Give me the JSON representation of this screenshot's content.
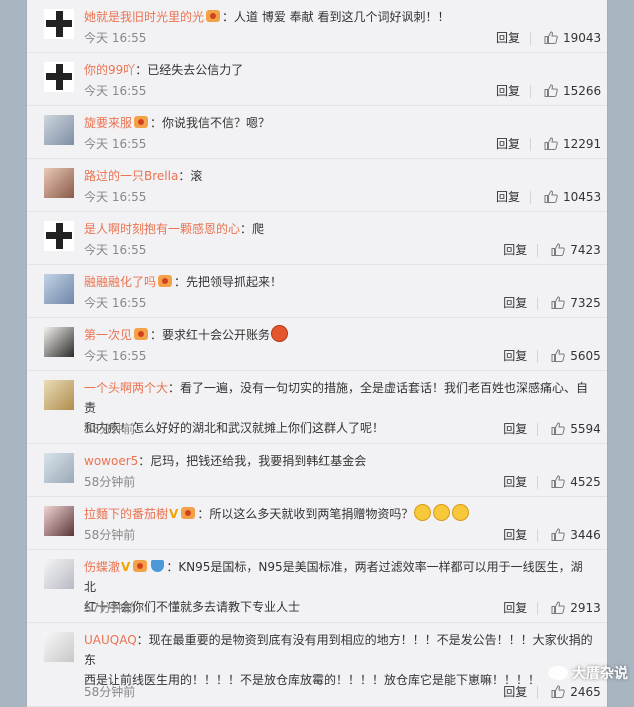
{
  "comments": [
    {
      "user": "她就是我旧时光里的光",
      "badge": "vip",
      "text": "：人道 博爱 奉献 看到这几个词好讽刺！！",
      "time": "今天 16:55",
      "reply": "回复",
      "likes": "19043",
      "avatar": "cross"
    },
    {
      "user": "你的99吖",
      "badge": "",
      "text": "：已经失去公信力了",
      "time": "今天 16:55",
      "reply": "回复",
      "likes": "15266",
      "avatar": "cross"
    },
    {
      "user": "旋要来服",
      "badge": "vip",
      "text": "：你说我信不信？嗯？",
      "time": "今天 16:55",
      "reply": "回复",
      "likes": "12291",
      "avatar": "photo a1"
    },
    {
      "user": "路过的一只Brella",
      "badge": "",
      "text": "：滚",
      "time": "今天 16:55",
      "reply": "回复",
      "likes": "10453",
      "avatar": "photo a2"
    },
    {
      "user": "是人啊时刻抱有一颗感恩的心",
      "badge": "",
      "text": "：爬",
      "time": "今天 16:55",
      "reply": "回复",
      "likes": "7423",
      "avatar": "cross"
    },
    {
      "user": "融融融化了吗",
      "badge": "vip",
      "text": "：先把领导抓起来！",
      "time": "今天 16:55",
      "reply": "回复",
      "likes": "7325",
      "avatar": "photo a3"
    },
    {
      "user": "第一次见",
      "badge": "vip",
      "text": "：要求红十会公开账务",
      "time": "今天 16:55",
      "reply": "回复",
      "likes": "5605",
      "avatar": "photo a4",
      "emoji_end": "red"
    },
    {
      "user": "一个头啊两个大",
      "badge": "",
      "text": "：看了一遍，没有一句切实的措施，全是虚话套话！我们老百姓也深感痛心、自责",
      "text2": "和内疚！怎么好好的湖北和武汉就摊上你们这群人了呢！",
      "time": "58分钟前",
      "reply": "回复",
      "likes": "5594",
      "avatar": "photo a5"
    },
    {
      "user": "wowoer5",
      "badge": "",
      "text": "：尼玛，把钱还给我，我要捐到韩红基金会",
      "time": "58分钟前",
      "reply": "回复",
      "likes": "4525",
      "avatar": "photo a6"
    },
    {
      "user": "拉麵下的番茄樹",
      "badge": "v+vip",
      "text": "：所以这么多天就收到两笔捐赠物资吗？",
      "time": "58分钟前",
      "reply": "回复",
      "likes": "3446",
      "avatar": "photo a7",
      "emoji_end": "three"
    },
    {
      "user": "伤蝶澈",
      "badge": "v+vip+shield",
      "text": "：KN95是国标，N95是美国标准，两者过滤效率一样都可以用于一线医生，湖北",
      "text2": "红十字会你们不懂就多去请教下专业人士",
      "time": "57分钟前",
      "reply": "回复",
      "likes": "2913",
      "avatar": "photo a8"
    },
    {
      "user": "UAUQAQ",
      "badge": "",
      "text": "：现在最重要的是物资到底有没有用到相应的地方！！！不是发公告！！！大家伙捐的东",
      "text2": "西是让前线医生用的！！！！不是放仓库放霉的！！！！放仓库它是能下崽嘛！！！！",
      "time": "58分钟前",
      "reply": "回复",
      "likes": "2465",
      "avatar": "photo a9"
    }
  ],
  "watermark": "大厝杂说",
  "colors": {
    "username": "#eb7350",
    "panel": "#f2f2f5",
    "background": "#a9b6c2"
  }
}
